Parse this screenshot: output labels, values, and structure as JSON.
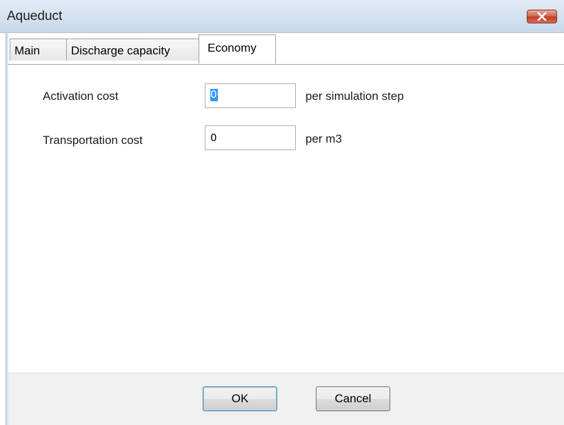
{
  "window": {
    "title": "Aqueduct"
  },
  "tabs": [
    {
      "label": "Main",
      "active": false
    },
    {
      "label": "Discharge capacity",
      "active": false
    },
    {
      "label": "Economy",
      "active": true
    }
  ],
  "form": {
    "activation_cost": {
      "label": "Activation cost",
      "value": "0",
      "unit": "per simulation step"
    },
    "transportation_cost": {
      "label": "Transportation cost",
      "value": "0",
      "unit": "per m3"
    }
  },
  "buttons": {
    "ok": "OK",
    "cancel": "Cancel"
  },
  "icons": {
    "close": "close-icon"
  },
  "colors": {
    "close_button": "#c23b25",
    "selection": "#3399ff",
    "titlebar": "#d2e0ee"
  }
}
